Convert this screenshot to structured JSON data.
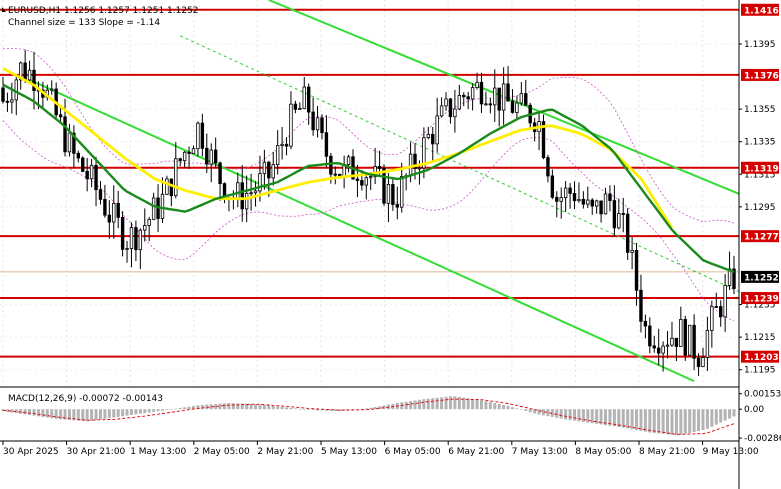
{
  "header": {
    "symbol_line": "EURUSD,H1  1.1256 1.1257 1.1251 1.1252",
    "channel_line": "Channel size = 133 Slope = -1.14"
  },
  "macd": {
    "label": "MACD(12,26,9) -0.00072 -0.00143",
    "ticks": [
      {
        "value": 0.00153,
        "label": "0.00153"
      },
      {
        "value": 0.0,
        "label": "0.00"
      },
      {
        "value": -0.00286,
        "label": "-0.00286"
      }
    ]
  },
  "chart_data": {
    "type": "candlestick",
    "price_range": [
      1.1185,
      1.1422
    ],
    "price_ticks": [
      {
        "value": 1.1395,
        "label": "1.1395"
      },
      {
        "value": 1.1355,
        "label": "1.1355"
      },
      {
        "value": 1.1335,
        "label": "1.1335"
      },
      {
        "value": 1.1315,
        "label": "1.1315"
      },
      {
        "value": 1.1295,
        "label": "1.1295"
      },
      {
        "value": 1.1235,
        "label": "1.1235"
      },
      {
        "value": 1.1215,
        "label": "1.1215"
      },
      {
        "value": 1.1195,
        "label": "1.1195"
      }
    ],
    "levels": [
      {
        "value": 1.1416,
        "label": "1.1416"
      },
      {
        "value": 1.1376,
        "label": "1.1376"
      },
      {
        "value": 1.1319,
        "label": "1.1319"
      },
      {
        "value": 1.1277,
        "label": "1.1277"
      },
      {
        "value": 1.1239,
        "label": "1.1239"
      },
      {
        "value": 1.1203,
        "label": "1.1203"
      }
    ],
    "current_price": {
      "value": 1.1252,
      "label": "1.1252"
    },
    "time_labels": [
      "30 Apr 2025",
      "30 Apr 21:00",
      "1 May 13:00",
      "2 May 05:00",
      "2 May 21:00",
      "5 May 13:00",
      "6 May 05:00",
      "6 May 21:00",
      "7 May 13:00",
      "8 May 05:00",
      "8 May 21:00",
      "9 May 13:00"
    ],
    "key_closes": [
      1.136,
      1.138,
      1.1375,
      1.135,
      1.1325,
      1.131,
      1.129,
      1.1275,
      1.1285,
      1.13,
      1.1325,
      1.1345,
      1.1315,
      1.13,
      1.1305,
      1.1315,
      1.1345,
      1.136,
      1.133,
      1.1315,
      1.132,
      1.131,
      1.13,
      1.132,
      1.134,
      1.1355,
      1.1365,
      1.137,
      1.136,
      1.1355,
      1.135,
      1.13,
      1.1305,
      1.129,
      1.13,
      1.1275,
      1.122,
      1.1215,
      1.1218,
      1.1205,
      1.123,
      1.1252
    ],
    "ma_yellow_key": [
      1.138,
      1.137,
      1.1355,
      1.134,
      1.1325,
      1.1312,
      1.1305,
      1.13,
      1.13,
      1.1305,
      1.131,
      1.1313,
      1.1315,
      1.1318,
      1.1322,
      1.1328,
      1.1335,
      1.1342,
      1.1345,
      1.134,
      1.133,
      1.1312,
      1.1282
    ],
    "ma_green_key": [
      1.137,
      1.136,
      1.1345,
      1.1325,
      1.1305,
      1.1295,
      1.1292,
      1.13,
      1.1305,
      1.131,
      1.132,
      1.1322,
      1.1315,
      1.1312,
      1.1318,
      1.1328,
      1.134,
      1.135,
      1.1355,
      1.1345,
      1.133,
      1.1305,
      1.128,
      1.1262,
      1.1255
    ],
    "macd_histogram_key": [
      -0.0002,
      -0.0006,
      -0.001,
      -0.0012,
      -0.0008,
      -0.0004,
      0.0,
      0.0004,
      0.0006,
      0.0005,
      0.0002,
      -0.0001,
      -0.0002,
      0.0001,
      0.0006,
      0.001,
      0.0013,
      0.0009,
      0.0003,
      -0.0005,
      -0.001,
      -0.0014,
      -0.0018,
      -0.0023,
      -0.0026,
      -0.002,
      -0.00072
    ],
    "macd_signal_key": [
      -0.0001,
      -0.0004,
      -0.0008,
      -0.0011,
      -0.001,
      -0.0007,
      -0.0003,
      0.0001,
      0.0004,
      0.0005,
      0.0003,
      5e-05,
      -0.0001,
      -5e-05,
      0.0003,
      0.0007,
      0.001,
      0.00095,
      0.00055,
      -0.0001,
      -0.0007,
      -0.0012,
      -0.0016,
      -0.0021,
      -0.0025,
      -0.0024,
      -0.00143
    ],
    "colors": {
      "level_red": "#d40000",
      "ma_yellow": "#ffee00",
      "ma_green": "#1a8a1a",
      "channel_green": "#33dd33",
      "channel_mid": "#33cc33",
      "envelope": "#cc55cc",
      "current_price_bg": "#000000",
      "macd_hist": "#b3b3b3",
      "macd_signal": "#e00000",
      "candle": "#000000"
    }
  }
}
